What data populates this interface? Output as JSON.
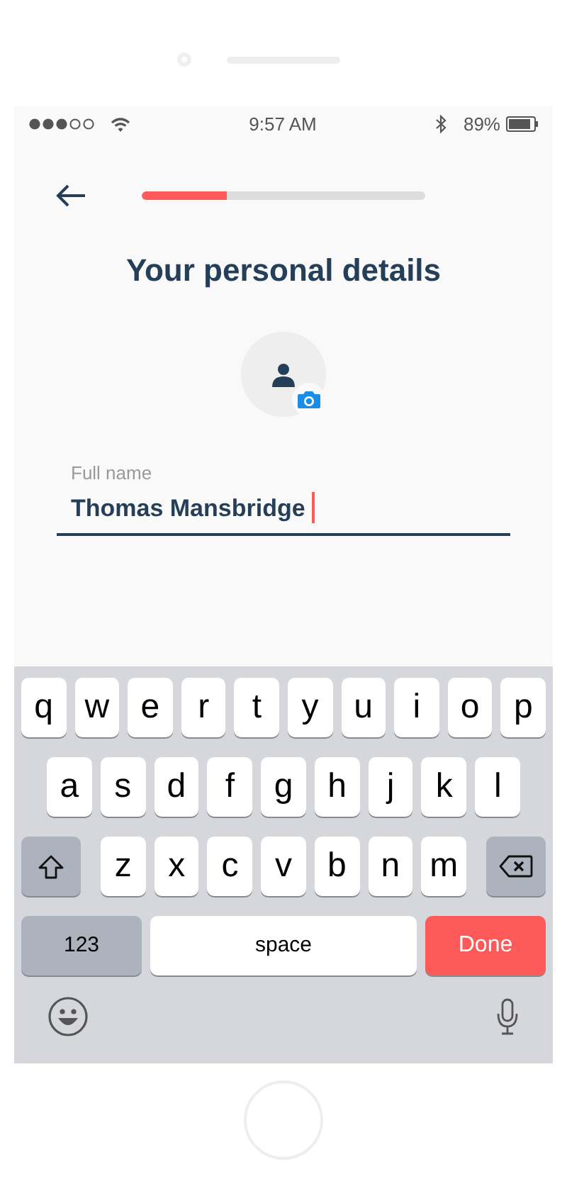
{
  "status_bar": {
    "time": "9:57 AM",
    "battery": "89%"
  },
  "progress": {
    "level": 0.3
  },
  "title": "Your personal details",
  "field": {
    "label": "Full name",
    "value": "Thomas Mansbridge",
    "focused": true
  },
  "keyboard": {
    "rows": [
      {
        "keys": [
          {
            "kind": "letter",
            "label": "q"
          },
          {
            "kind": "letter",
            "label": "w"
          },
          {
            "kind": "letter",
            "label": "e"
          },
          {
            "kind": "letter",
            "label": "r"
          },
          {
            "kind": "letter",
            "label": "t"
          },
          {
            "kind": "letter",
            "label": "y"
          },
          {
            "kind": "letter",
            "label": "u"
          },
          {
            "kind": "letter",
            "label": "i"
          },
          {
            "kind": "letter",
            "label": "o"
          },
          {
            "kind": "letter",
            "label": "p"
          }
        ]
      },
      {
        "keys": [
          {
            "kind": "letter",
            "label": "a"
          },
          {
            "kind": "letter",
            "label": "s"
          },
          {
            "kind": "letter",
            "label": "d"
          },
          {
            "kind": "letter",
            "label": "f"
          },
          {
            "kind": "letter",
            "label": "g"
          },
          {
            "kind": "letter",
            "label": "h"
          },
          {
            "kind": "letter",
            "label": "j"
          },
          {
            "kind": "letter",
            "label": "k"
          },
          {
            "kind": "letter",
            "label": "l"
          }
        ]
      },
      {
        "keys": [
          {
            "kind": "shift"
          },
          {
            "kind": "letter",
            "label": "z"
          },
          {
            "kind": "letter",
            "label": "x"
          },
          {
            "kind": "letter",
            "label": "c"
          },
          {
            "kind": "letter",
            "label": "v"
          },
          {
            "kind": "letter",
            "label": "b"
          },
          {
            "kind": "letter",
            "label": "n"
          },
          {
            "kind": "letter",
            "label": "m"
          },
          {
            "kind": "delete"
          }
        ]
      },
      {
        "keys": [
          {
            "kind": "mode",
            "label": "123"
          },
          {
            "kind": "space",
            "label": "space"
          },
          {
            "kind": "done",
            "label": "Done"
          }
        ]
      }
    ]
  }
}
